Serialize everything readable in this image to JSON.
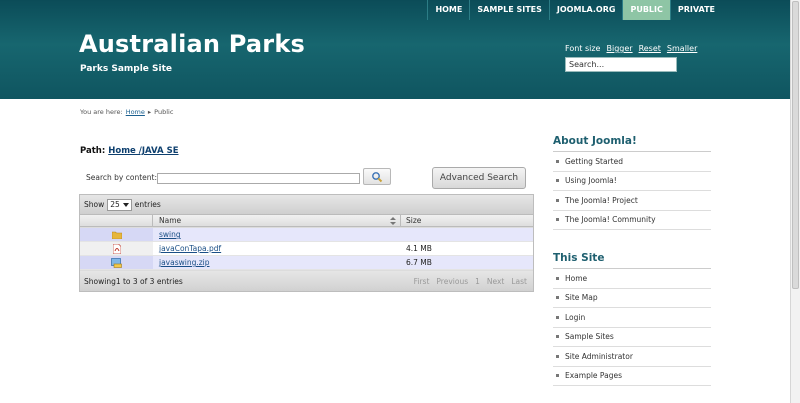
{
  "nav": {
    "items": [
      {
        "label": "HOME"
      },
      {
        "label": "SAMPLE SITES"
      },
      {
        "label": "JOOMLA.ORG"
      },
      {
        "label": "PUBLIC"
      },
      {
        "label": "PRIVATE"
      }
    ],
    "active": "PUBLIC"
  },
  "site": {
    "title": "Australian Parks",
    "subtitle": "Parks Sample Site"
  },
  "fontsize": {
    "label": "Font size",
    "bigger": "Bigger",
    "reset": "Reset",
    "smaller": "Smaller"
  },
  "search": {
    "value": "Search..."
  },
  "breadcrumb": {
    "prefix": "You are here:",
    "home": "Home",
    "sep": "▸",
    "current": "Public"
  },
  "path": {
    "label": "Path:",
    "link": "Home /JAVA SE"
  },
  "content_search": {
    "label": "Search by content:",
    "value": "",
    "advanced": "Advanced Search"
  },
  "table": {
    "show_label": "Show",
    "show_value": "25",
    "entries_label": "entries",
    "columns": [
      "Name",
      "Size"
    ],
    "rows": [
      {
        "icon": "folder-icon",
        "name": "swing",
        "size": ""
      },
      {
        "icon": "pdf-icon",
        "name": "javaConTapa.pdf",
        "size": "4.1 MB"
      },
      {
        "icon": "zip-icon",
        "name": "javaswing.zip",
        "size": "6.7 MB"
      }
    ],
    "info": "Showing1 to 3 of 3 entries",
    "pager": [
      "First",
      "Previous",
      "1",
      "Next",
      "Last"
    ]
  },
  "sidebar": {
    "about": {
      "title": "About Joomla!",
      "items": [
        "Getting Started",
        "Using Joomla!",
        "The Joomla! Project",
        "The Joomla! Community"
      ]
    },
    "site": {
      "title": "This Site",
      "items": [
        "Home",
        "Site Map",
        "Login",
        "Sample Sites",
        "Site Administrator",
        "Example Pages"
      ]
    }
  },
  "colors": {
    "header": "#17666f",
    "nav_active": "#8ec5a5",
    "link": "#1a4f86",
    "side_title": "#1e5f6f"
  }
}
